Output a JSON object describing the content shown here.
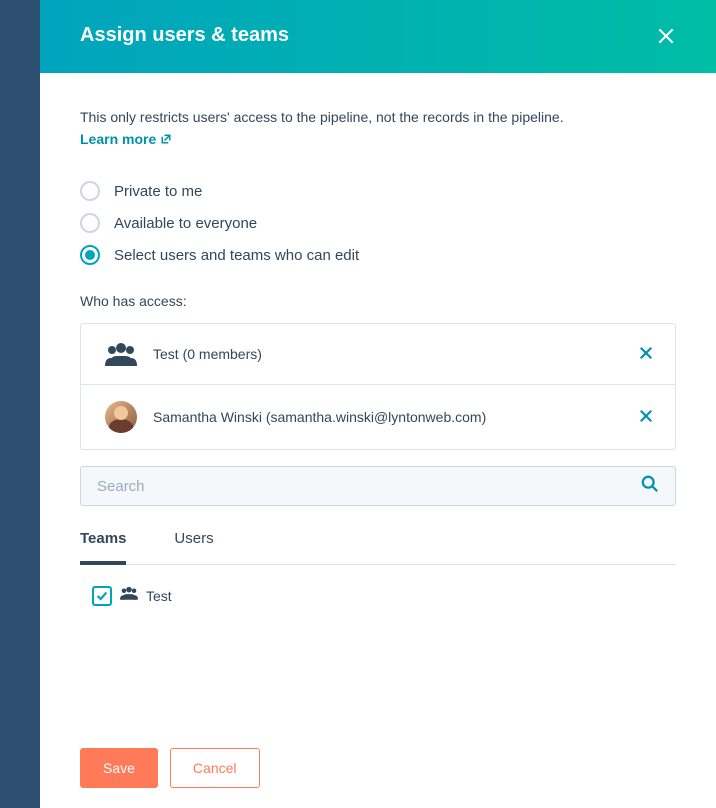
{
  "header": {
    "title": "Assign users & teams"
  },
  "intro": "This only restricts users' access to the pipeline, not the records in the pipeline.",
  "learn_more": "Learn more",
  "radios": {
    "private": "Private to me",
    "everyone": "Available to everyone",
    "select": "Select users and teams who can edit"
  },
  "who_label": "Who has access:",
  "access": {
    "team": "Test (0 members)",
    "user": "Samantha Winski (samantha.winski@lyntonweb.com)"
  },
  "search": {
    "placeholder": "Search"
  },
  "tabs": {
    "teams": "Teams",
    "users": "Users"
  },
  "list": {
    "item1": "Test"
  },
  "buttons": {
    "save": "Save",
    "cancel": "Cancel"
  }
}
